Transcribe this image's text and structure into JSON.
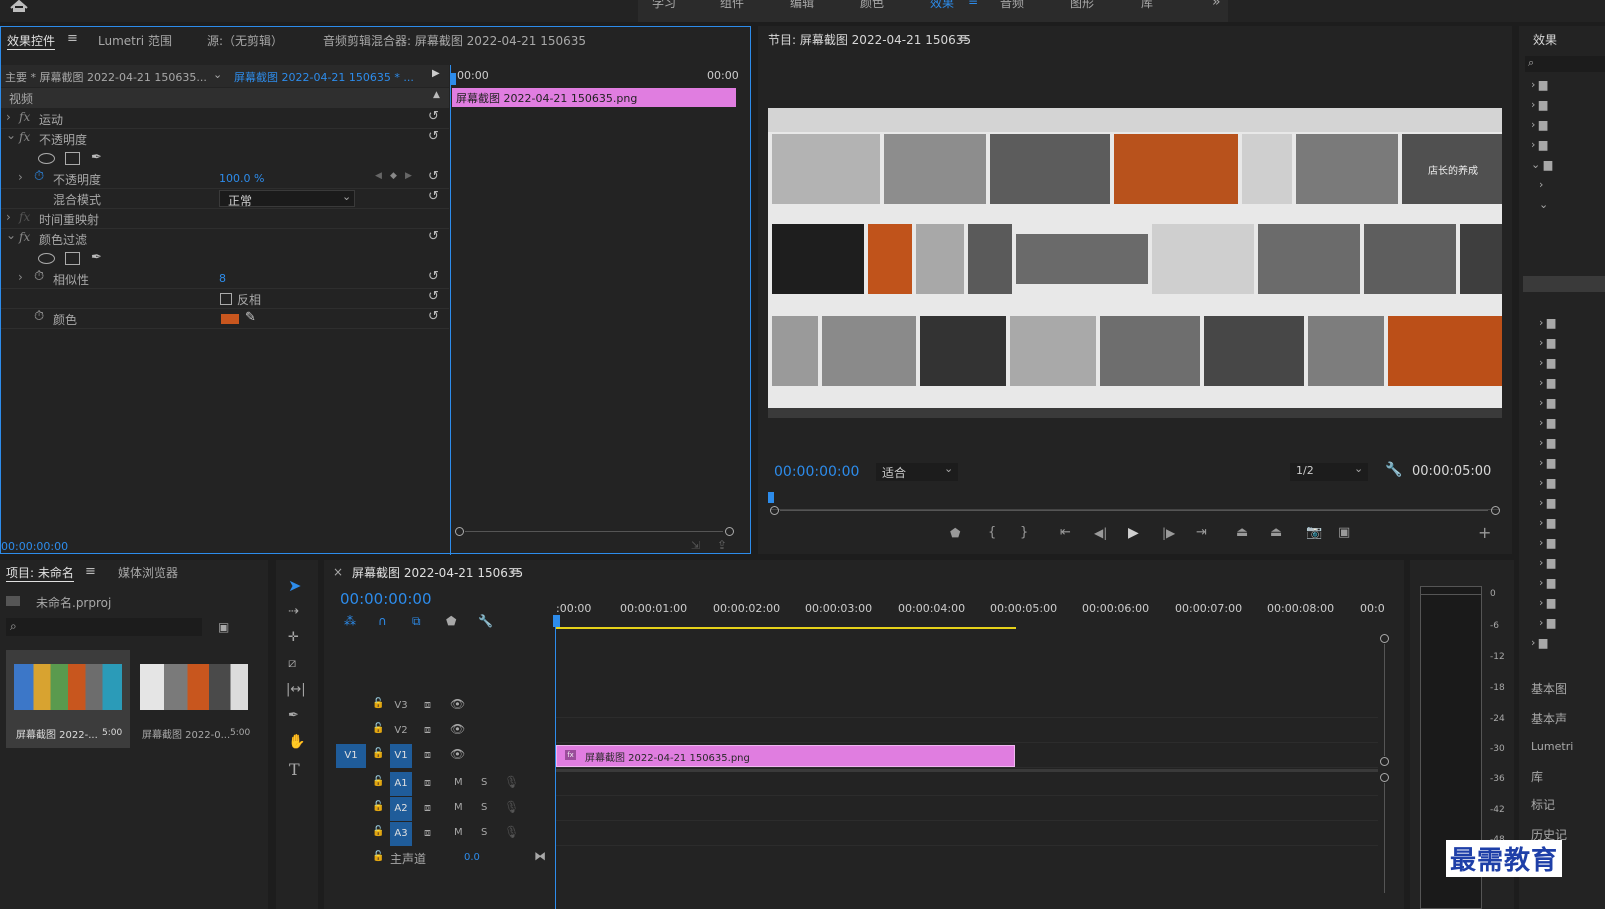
{
  "workspaces": {
    "items": [
      "学习",
      "组件",
      "编辑",
      "颜色",
      "效果",
      "音频",
      "图形",
      "库"
    ],
    "active_index": 4,
    "more": "»"
  },
  "effect_controls": {
    "tabs": [
      "效果控件",
      "Lumetri 范围",
      "源:（无剪辑）",
      "音频剪辑混合器: 屏幕截图 2022-04-21 150635"
    ],
    "master_label": "主要 * 屏幕截图 2022-04-21 150635...",
    "clip_label": "屏幕截图 2022-04-21 150635 * ...",
    "ruler_start": "00:00",
    "ruler_end": "00:00",
    "clip_bar": "屏幕截图 2022-04-21  150635.png",
    "section_video": "视频",
    "motion": "运动",
    "opacity": "不透明度",
    "opacity_param": "不透明度",
    "opacity_value": "100.0 %",
    "blend_label": "混合模式",
    "blend_value": "正常",
    "time_remap": "时间重映射",
    "color_pass": "颜色过滤",
    "similarity": "相似性",
    "similarity_value": "8",
    "invert": "反相",
    "color": "颜色",
    "color_value": "#c8561e",
    "timecode": "00:00:00:00"
  },
  "program": {
    "title": "节目: 屏幕截图 2022-04-21 150635",
    "timecode": "00:00:00:00",
    "fit": "适合",
    "resolution": "1/2",
    "duration": "00:00:05:00",
    "overlay_text": "店长的养成"
  },
  "effects_panel": {
    "title": "效果",
    "bottom_items": [
      "基本图",
      "基本声",
      "Lumetri",
      "库",
      "标记",
      "历史记"
    ]
  },
  "project": {
    "tabs": [
      "项目: 未命名",
      "媒体浏览器"
    ],
    "file": "未命名.prproj",
    "items": [
      {
        "name": "屏幕截图 2022-...",
        "dur": "5:00"
      },
      {
        "name": "屏幕截图 2022-0...",
        "dur": "5:00"
      }
    ]
  },
  "timeline": {
    "title": "屏幕截图 2022-04-21 150635",
    "timecode": "00:00:00:00",
    "ruler": [
      ":00:00",
      "00:00:01:00",
      "00:00:02:00",
      "00:00:03:00",
      "00:00:04:00",
      "00:00:05:00",
      "00:00:06:00",
      "00:00:07:00",
      "00:00:08:00",
      "00:0"
    ],
    "video_tracks": [
      "V3",
      "V2",
      "V1"
    ],
    "audio_tracks": [
      "A1",
      "A2",
      "A3"
    ],
    "source_patch": "V1",
    "clip": "屏幕截图  2022-04-21  150635.png",
    "master": "主声道",
    "master_value": "0.0",
    "mute": "M",
    "solo": "S"
  },
  "meter": {
    "ticks": [
      "0",
      "-6",
      "-12",
      "-18",
      "-24",
      "-30",
      "-36",
      "-42",
      "-48"
    ]
  },
  "watermark": "最需教育"
}
